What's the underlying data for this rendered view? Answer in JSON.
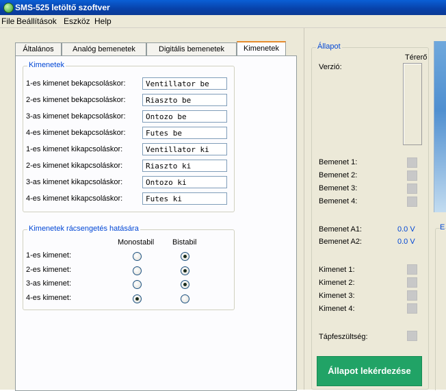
{
  "window": {
    "title": "SMS-525 letöltő szoftver"
  },
  "menu": [
    "File",
    "Beállítások",
    "Eszköz",
    "Help"
  ],
  "tabs": [
    "Általános",
    "Analóg bemenetek",
    "Digitális bemenetek",
    "Kimenetek"
  ],
  "active_tab": "Kimenetek",
  "outputs_group": {
    "title": "Kimenetek",
    "rows": [
      {
        "label": "1-es kimenet bekapcsoláskor:",
        "value": "Ventillator be"
      },
      {
        "label": "2-es kimenet bekapcsoláskor:",
        "value": "Riaszto be"
      },
      {
        "label": "3-as kimenet bekapcsoláskor:",
        "value": "Ontozo be"
      },
      {
        "label": "4-es kimenet bekapcsoláskor:",
        "value": "Futes be"
      },
      {
        "label": "1-es kimenet kikapcsoláskor:",
        "value": "Ventillator ki"
      },
      {
        "label": "2-es kimenet kikapcsoláskor:",
        "value": "Riaszto ki"
      },
      {
        "label": "3-as kimenet kikapcsoláskor:",
        "value": "Ontozo ki"
      },
      {
        "label": "4-es kimenet kikapcsoláskor:",
        "value": "Futes ki"
      }
    ]
  },
  "ring_group": {
    "title": "Kimenetek rácsengetés hatására",
    "col_mono": "Monostabil",
    "col_bi": "Bistabil",
    "rows": [
      {
        "label": "1-es kimenet:",
        "selected": "bistabil"
      },
      {
        "label": "2-es kimenet:",
        "selected": "bistabil"
      },
      {
        "label": "3-as kimenet:",
        "selected": "bistabil"
      },
      {
        "label": "4-es kimenet:",
        "selected": "monostabil"
      }
    ]
  },
  "status": {
    "title": "Állapot",
    "signal_label": "Térerő",
    "version_label": "Verzió:",
    "inputs": [
      "Bemenet 1:",
      "Bemenet 2:",
      "Bemenet 3:",
      "Bemenet 4:"
    ],
    "analog": [
      {
        "label": "Bemenet A1:",
        "value": "0.0 V"
      },
      {
        "label": "Bemenet A2:",
        "value": "0.0 V"
      }
    ],
    "outputs": [
      "Kimenet 1:",
      "Kimenet 2:",
      "Kimenet 3:",
      "Kimenet 4:"
    ],
    "supply_label": "Tápfeszültség:",
    "query_button": "Állapot lekérdezése"
  },
  "right_edge_group_label": "E",
  "colors": {
    "titlebar": "#0a4fc4",
    "accent_blue": "#0046d5",
    "button_green": "#21a366",
    "tab_highlight": "#e68b2c"
  }
}
